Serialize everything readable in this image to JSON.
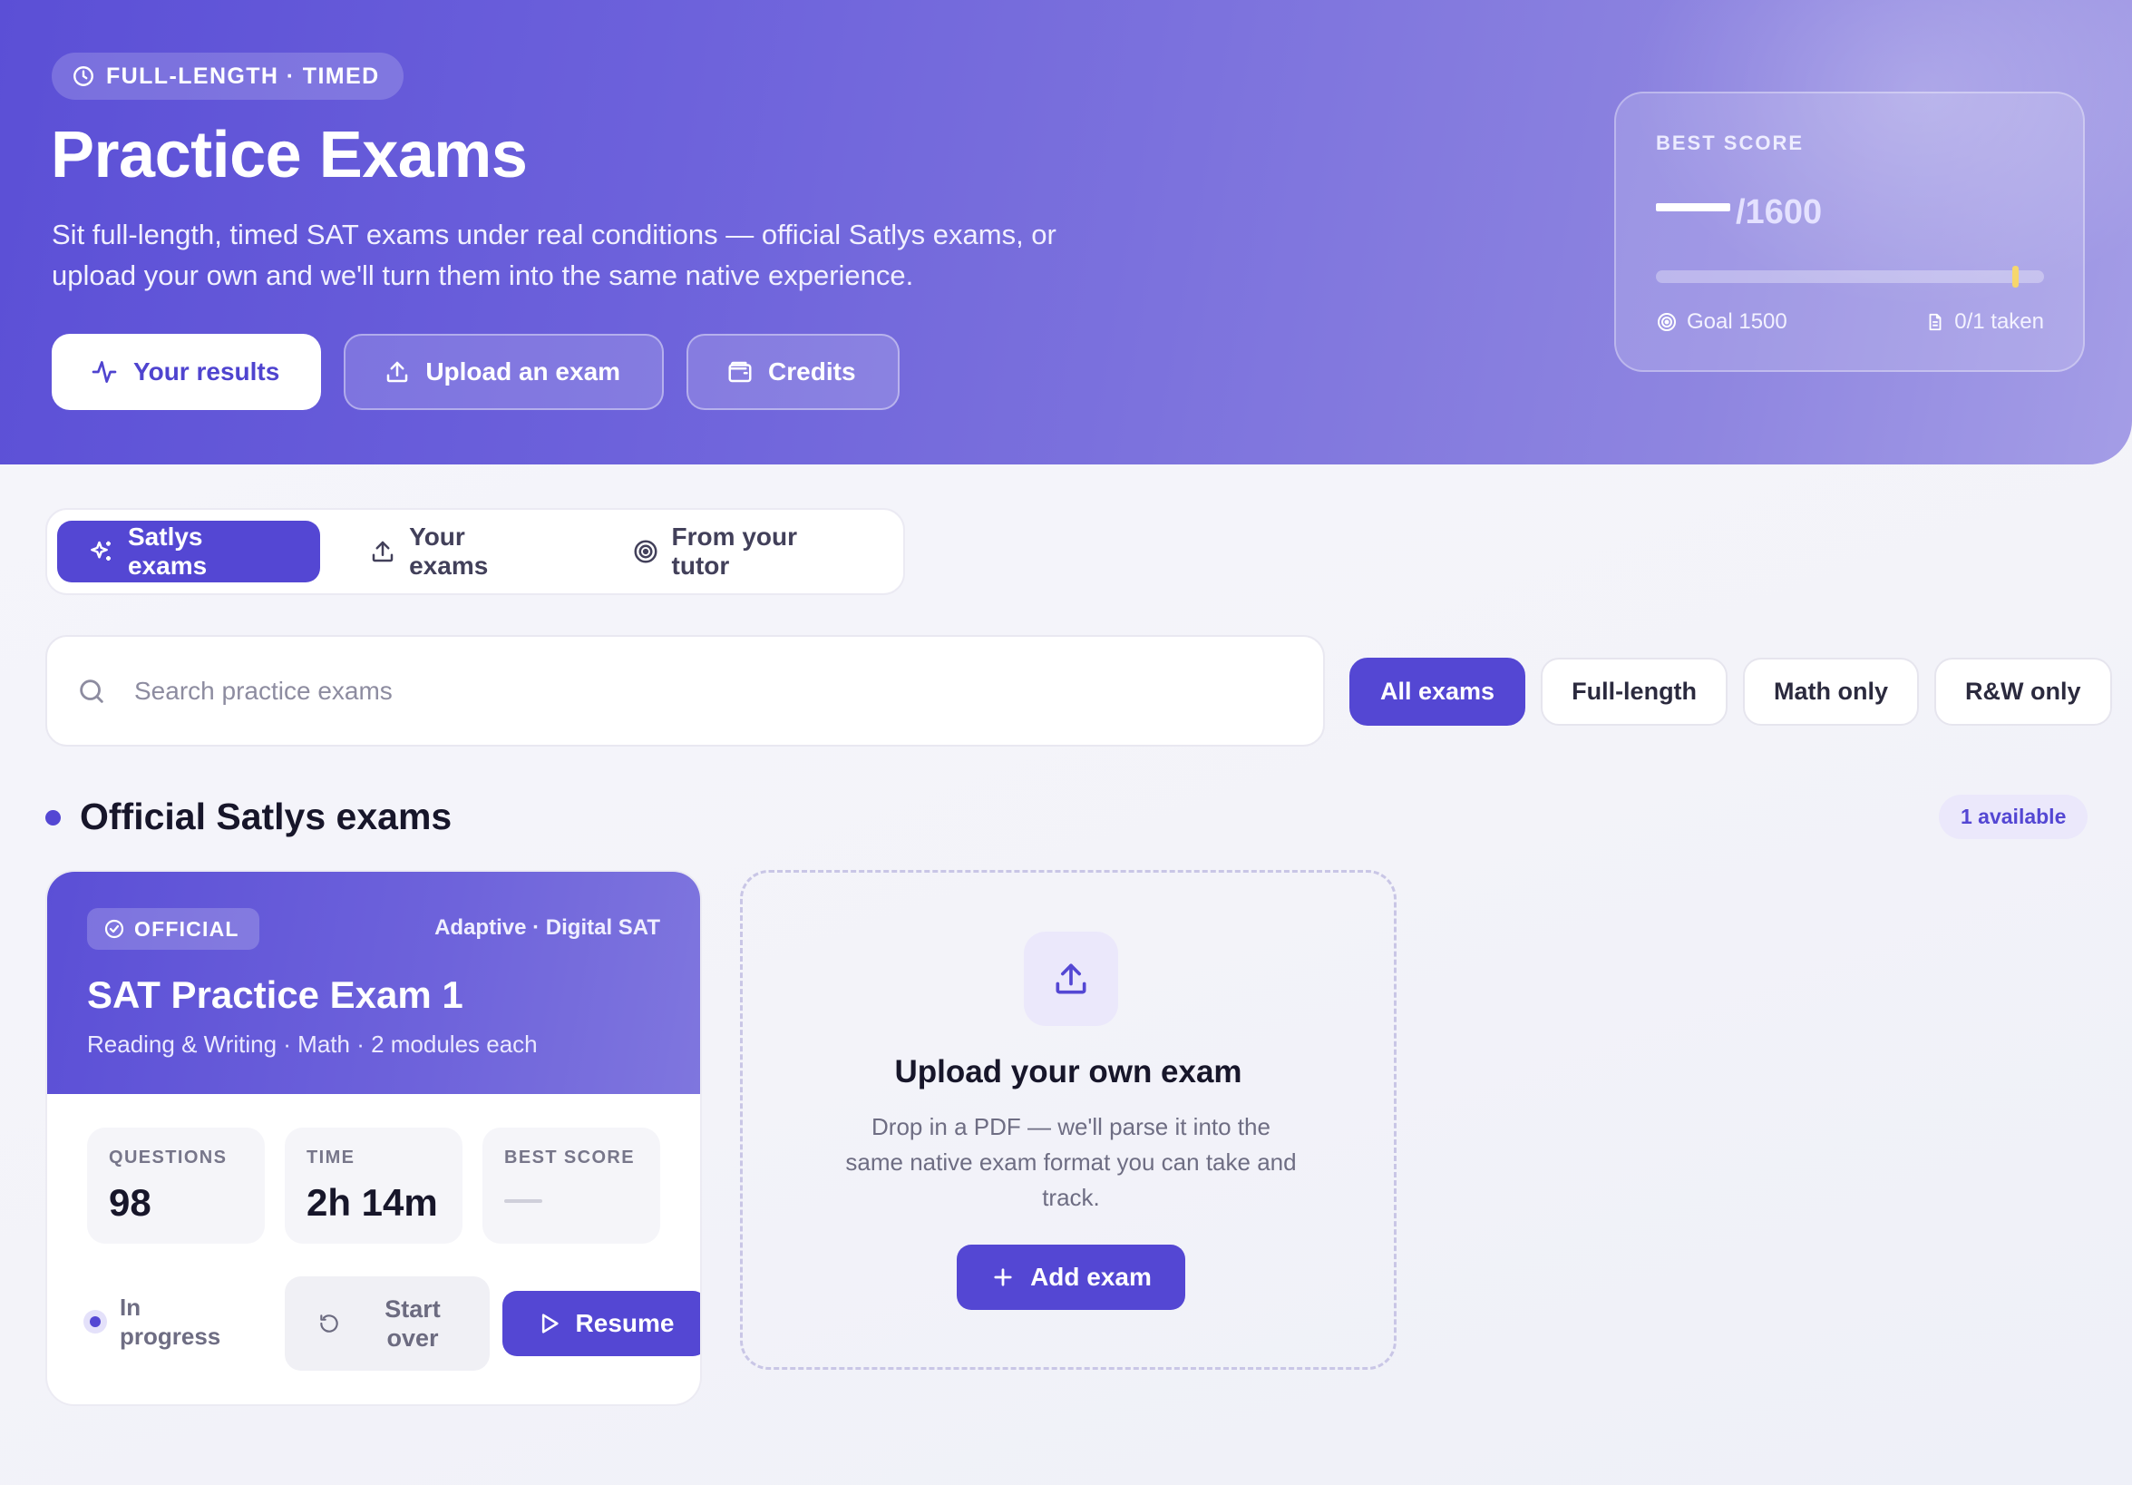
{
  "hero": {
    "eyebrow": "FULL-LENGTH · TIMED",
    "title": "Practice Exams",
    "subtitle": "Sit full-length, timed SAT exams under real conditions — official Satlys exams, or upload your own and we'll turn them into the same native experience.",
    "actions": {
      "results_label": "Your results",
      "upload_label": "Upload an exam",
      "credits_label": "Credits"
    },
    "best_score": {
      "label": "BEST SCORE",
      "max": "/1600",
      "goal_fraction": 0.925,
      "goal": "Goal 1500",
      "taken": "0/1 taken"
    }
  },
  "tabs": {
    "satlys": "Satlys exams",
    "yours": "Your exams",
    "tutor": "From your tutor",
    "active": "satlys"
  },
  "search": {
    "placeholder": "Search practice exams"
  },
  "filters": {
    "all": "All exams",
    "full": "Full-length",
    "math": "Math only",
    "rw": "R&W only",
    "active": "all"
  },
  "section": {
    "title": "Official Satlys exams",
    "badge": "1 available"
  },
  "exam": {
    "badge": "OFFICIAL",
    "tag": "Adaptive · Digital SAT",
    "title": "SAT Practice Exam 1",
    "subtitle": "Reading & Writing · Math · 2 modules each",
    "stats": {
      "questions_label": "QUESTIONS",
      "questions_value": "98",
      "time_label": "TIME",
      "time_value": "2h 14m",
      "best_label": "BEST SCORE"
    },
    "status": "In progress",
    "start_over_label": "Start over",
    "resume_label": "Resume"
  },
  "upload_card": {
    "title": "Upload your own exam",
    "description": "Drop in a PDF — we'll parse it into the same native exam format you can take and track.",
    "button_label": "Add exam"
  },
  "colors": {
    "accent": "#5447d3",
    "hero_start": "#5b4fd6",
    "hero_end": "#a49de6",
    "goal_marker": "#f6d66a"
  }
}
